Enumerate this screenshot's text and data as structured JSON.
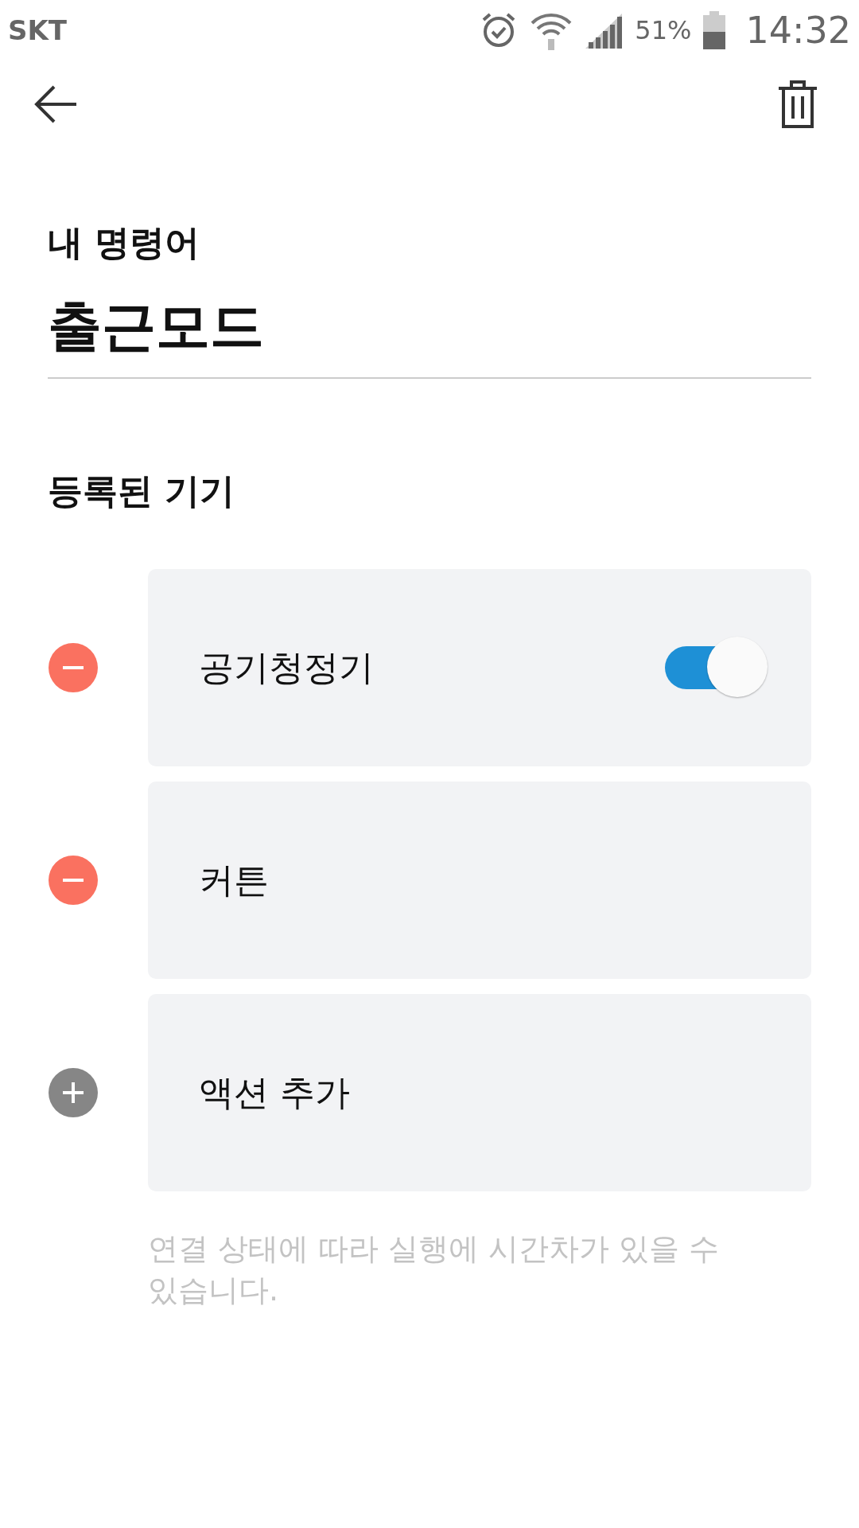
{
  "status_bar": {
    "carrier": "SKT",
    "battery": "51%",
    "time": "14:32"
  },
  "header": {
    "section_label": "내 명령어",
    "command_name": "출근모드"
  },
  "devices_title": "등록된 기기",
  "rows": [
    {
      "kind": "remove",
      "label": "공기청정기",
      "toggle": {
        "on": true
      }
    },
    {
      "kind": "remove",
      "label": "커튼"
    },
    {
      "kind": "add",
      "label": "액션 추가"
    }
  ],
  "note": "연결 상태에 따라 실행에 시간차가 있을 수 있습니다."
}
